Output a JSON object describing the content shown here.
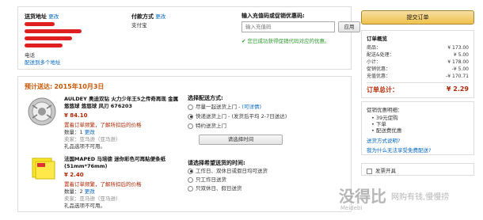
{
  "address": {
    "title": "送货地址",
    "change": "更改",
    "phone_label": "电话",
    "ship_multi": "配送到多个地址"
  },
  "payment": {
    "title": "付款方式",
    "change": "更改",
    "method": "支付宝"
  },
  "gift_card": {
    "title": "输入充值码或促销优惠码:",
    "placeholder": "输入充值码",
    "apply_label": "应用",
    "success": "您已成功获得促销代码对应的优惠。"
  },
  "shipment": {
    "eta_label": "预计送达:",
    "eta_date": "2015年10月3日",
    "items": [
      {
        "title": "AULDEY 奥迪双钻 火力少年王5之传奇再现 金属悠悠球 悠悠球 风刃 676203",
        "price": "¥ 84.10",
        "note": "置着订单频繁，了解所扣后的价格",
        "qty_label": "数量：",
        "qty": "1",
        "change": "更改",
        "seller": "卖家：亚马逊（亚马逊）",
        "gift_option": "礼品选项不可用。"
      },
      {
        "title": "法国MAPED 马培德 迷你彩色可再贴便条纸(51mm*76mm)",
        "price": "¥ 2.40",
        "note": "置着订单频繁，了解所扣后的价格",
        "qty_label": "数量：",
        "qty": "2",
        "change": "更改",
        "seller": "卖家：亚马逊（亚马逊）",
        "gift_option": "礼品选项不可用。"
      }
    ],
    "delivery_title": "选择配送方式:",
    "delivery_options": [
      {
        "label": "尽量一起送货上门 -",
        "extra": "(可详情)",
        "selected": false
      },
      {
        "label": "快递送货上门 -",
        "extra": "(发货后平均 2-7日送达)",
        "selected": true
      },
      {
        "label": "特约送货上门",
        "extra": "",
        "selected": false
      }
    ],
    "select_time_btn": "请选择时间",
    "time_title": "请选择希望送货的时间:",
    "time_options": [
      {
        "label": "工作日、双休日或假日均可送货",
        "selected": true
      },
      {
        "label": "只工作日送货",
        "selected": false
      },
      {
        "label": "只双休日、假日送货",
        "selected": false
      }
    ]
  },
  "summary": {
    "place_order": "提交订单",
    "title": "订单概览",
    "rows": [
      {
        "label": "商品：",
        "value": "¥ 173.00"
      },
      {
        "label": "配送&处理：",
        "value": "¥ 5.00"
      },
      {
        "label": "小计：",
        "value": "¥ 178.00"
      },
      {
        "label": "促销优惠：",
        "value": "-¥ 5.00"
      },
      {
        "label": "充值优惠：",
        "value": "-¥ 170.71"
      }
    ],
    "total_label": "订单总计：",
    "total_value": "¥ 2.29"
  },
  "promotions": {
    "title": "促销优惠明细：",
    "items": [
      "39元促购",
      "下单",
      "配送费优惠"
    ],
    "link1": "送货方式说明?",
    "link2": "我为什么无法享受免费配送?"
  },
  "gift_box": {
    "label": "发票开具"
  },
  "watermark": {
    "text": "没得比",
    "sub": "Meidebi",
    "slogan": "网购有钱,慢慢捞"
  },
  "colors": {
    "accent": "#c45500",
    "price": "#b12704",
    "link": "#0066c0",
    "success": "#2a9a2a",
    "button": "#f0c14b"
  }
}
